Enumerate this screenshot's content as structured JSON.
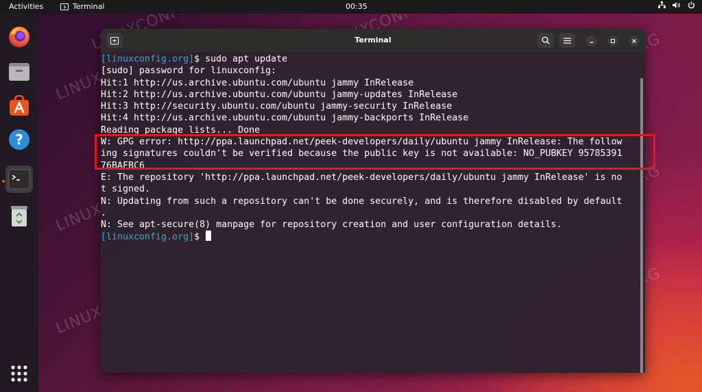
{
  "topbar": {
    "activities": "Activities",
    "app_name": "Terminal",
    "clock": "00:35"
  },
  "dock": {
    "items": [
      {
        "icon": "firefox-icon"
      },
      {
        "icon": "files-icon"
      },
      {
        "icon": "software-center-icon"
      },
      {
        "icon": "help-icon"
      },
      {
        "icon": "terminal-icon",
        "active": true
      },
      {
        "icon": "trash-icon"
      },
      {
        "icon": "show-apps-icon"
      }
    ]
  },
  "window": {
    "title": "Terminal"
  },
  "terminal": {
    "lines": [
      {
        "prompt": "[linuxconfig.org]",
        "text": "$ sudo apt update"
      },
      {
        "prompt": "",
        "text": "[sudo] password for linuxconfig:"
      },
      {
        "prompt": "",
        "text": "Hit:1 http://us.archive.ubuntu.com/ubuntu jammy InRelease"
      },
      {
        "prompt": "",
        "text": "Hit:2 http://us.archive.ubuntu.com/ubuntu jammy-updates InRelease"
      },
      {
        "prompt": "",
        "text": "Hit:3 http://security.ubuntu.com/ubuntu jammy-security InRelease"
      },
      {
        "prompt": "",
        "text": "Hit:4 http://us.archive.ubuntu.com/ubuntu jammy-backports InRelease"
      },
      {
        "prompt": "",
        "text": "Reading package lists... Done"
      },
      {
        "prompt": "",
        "text": "W: GPG error: http://ppa.launchpad.net/peek-developers/daily/ubuntu jammy InRelease: The follow"
      },
      {
        "prompt": "",
        "text": "ing signatures couldn't be verified because the public key is not available: NO_PUBKEY 95785391"
      },
      {
        "prompt": "",
        "text": "76BAFBC6"
      },
      {
        "prompt": "",
        "text": "E: The repository 'http://ppa.launchpad.net/peek-developers/daily/ubuntu jammy InRelease' is no"
      },
      {
        "prompt": "",
        "text": "t signed."
      },
      {
        "prompt": "",
        "text": "N: Updating from such a repository can't be done securely, and is therefore disabled by default"
      },
      {
        "prompt": "",
        "text": "."
      },
      {
        "prompt": "",
        "text": "N: See apt-secure(8) manpage for repository creation and user configuration details."
      },
      {
        "prompt": "[linuxconfig.org]",
        "text": "$ ",
        "cursor": true
      }
    ]
  },
  "watermark": "LINUXCONFIG.ORG",
  "colors": {
    "prompt": "#3fa5c8",
    "highlight": "#e01b1b",
    "accent": "#e95420"
  }
}
